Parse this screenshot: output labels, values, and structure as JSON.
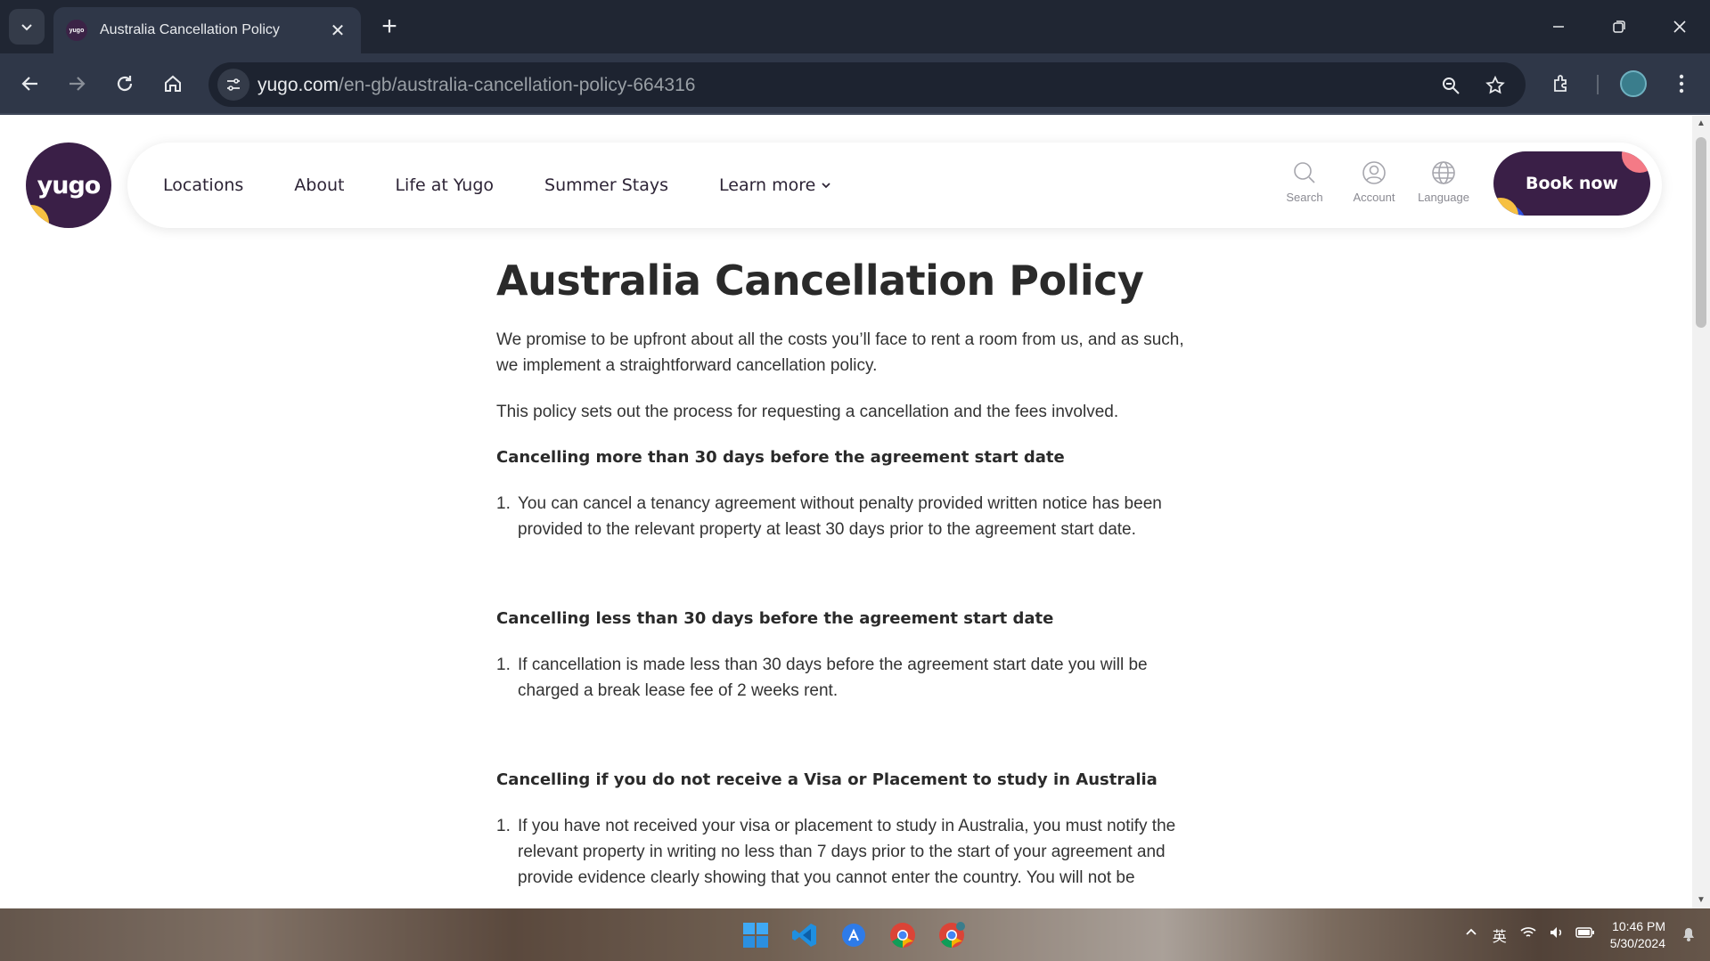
{
  "browser": {
    "tab_title": "Australia Cancellation Policy",
    "favicon_text": "yugo",
    "url_domain": "yugo.com",
    "url_path": "/en-gb/australia-cancellation-policy-664316"
  },
  "site": {
    "logo_text": "yugo",
    "nav": {
      "items": [
        {
          "label": "Locations"
        },
        {
          "label": "About"
        },
        {
          "label": "Life at Yugo"
        },
        {
          "label": "Summer Stays"
        },
        {
          "label": "Learn more"
        }
      ]
    },
    "utils": {
      "search_label": "Search",
      "account_label": "Account",
      "language_label": "Language"
    },
    "book_label": "Book now",
    "colors": {
      "brand": "#3a1f47",
      "yellow": "#f6c042",
      "pink": "#f47a86",
      "blue": "#2b4de0"
    }
  },
  "content": {
    "title": "Australia Cancellation Policy",
    "intro": "We promise to be upfront about all the costs you’ll face to rent a room from us, and as such, we implement a straightforward cancellation policy.",
    "intro2": "This policy sets out the process for requesting a cancellation and the fees involved.",
    "sections": [
      {
        "heading": "Cancelling more than 30 days before the agreement start date",
        "num": "1.",
        "item": "You can cancel a tenancy agreement without penalty provided written notice has been provided to the relevant property at least 30 days prior to the agreement start date."
      },
      {
        "heading": "Cancelling less than 30 days before the agreement start date",
        "num": "1.",
        "item": "If cancellation is made less than 30 days before the agreement start date you will be charged a break lease fee of 2 weeks rent."
      },
      {
        "heading": "Cancelling if you do not receive a Visa or Placement to study in Australia",
        "num": "1.",
        "item": "If you have not received your visa or placement to study in Australia, you must notify the relevant property in writing no less than 7 days prior to the start of your agreement and provide evidence clearly showing that you cannot enter the country. You will not be"
      }
    ]
  },
  "taskbar": {
    "apps": [
      "windows-start",
      "vscode",
      "app-store",
      "chrome-1",
      "chrome-2"
    ],
    "tray_lang": "英",
    "time": "10:46 PM",
    "date": "5/30/2024"
  }
}
